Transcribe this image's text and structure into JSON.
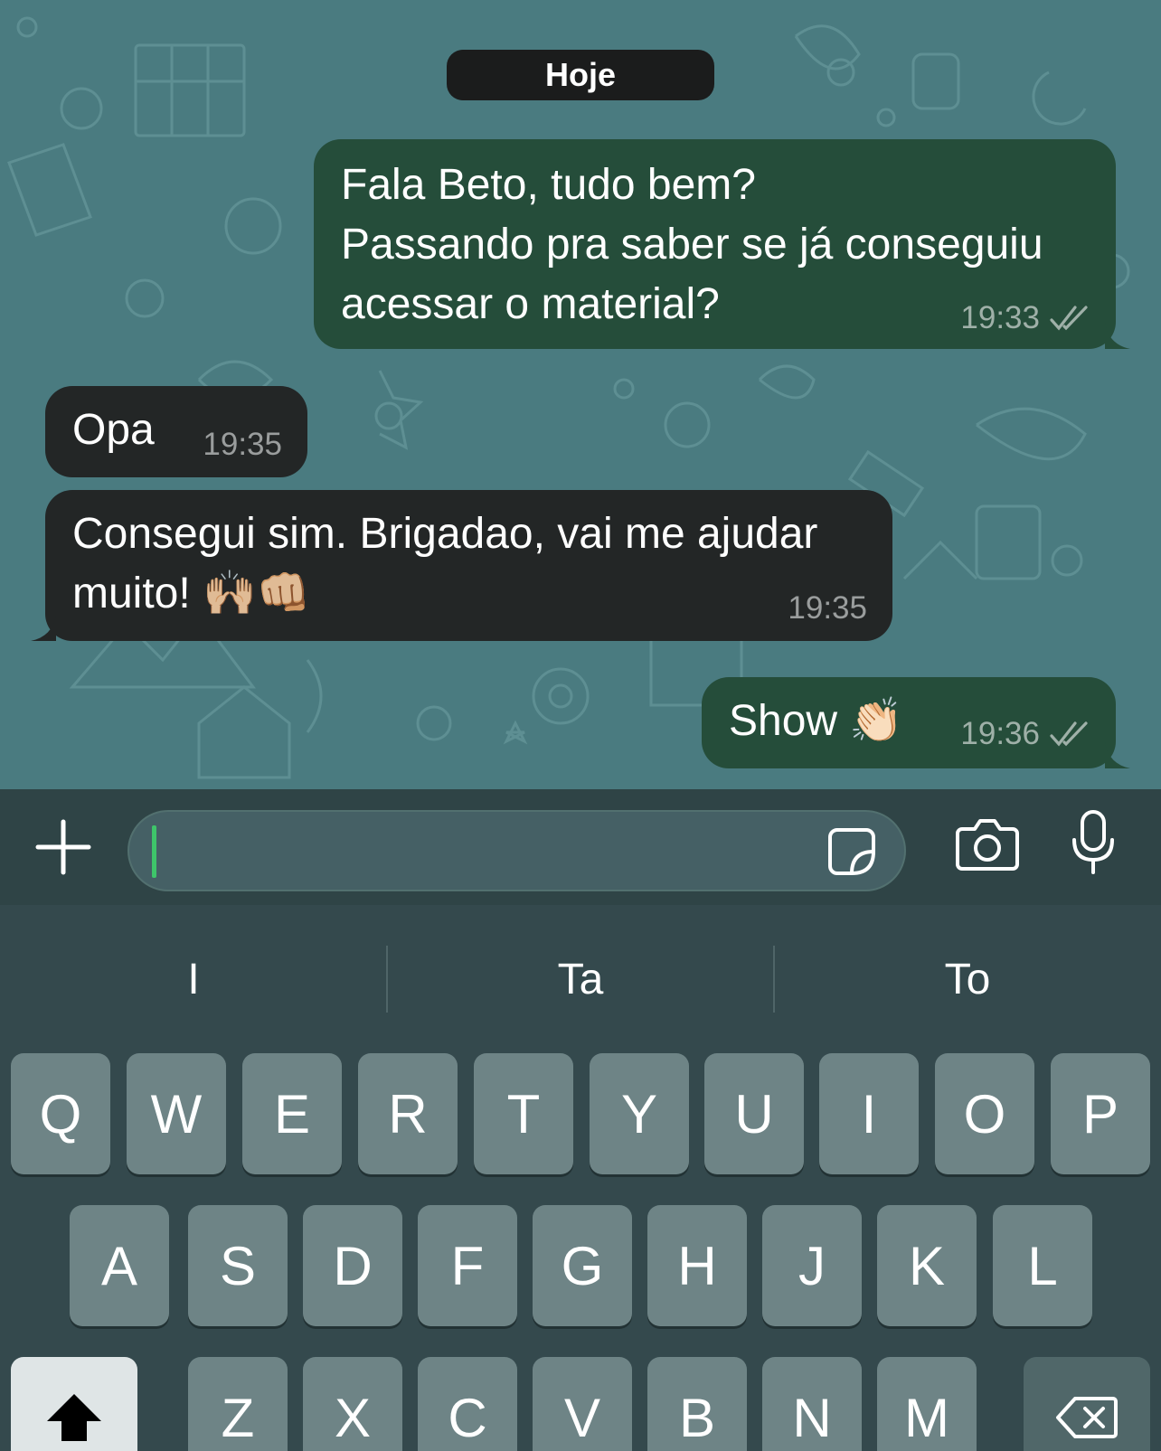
{
  "date_label": "Hoje",
  "messages": [
    {
      "direction": "outgoing",
      "text": "Fala Beto, tudo bem?\nPassando pra saber se já conseguiu\nacessar o material?",
      "time": "19:33",
      "status": "read"
    },
    {
      "direction": "incoming",
      "text": "Opa",
      "time": "19:35"
    },
    {
      "direction": "incoming",
      "text": "Consegui sim. Brigadao, vai me ajudar\nmuito! 🙌🏼👊🏼",
      "time": "19:35"
    },
    {
      "direction": "outgoing",
      "text": "Show 👏🏻",
      "time": "19:36",
      "status": "read"
    }
  ],
  "composer": {
    "input_value": "",
    "icons": [
      "plus-icon",
      "sticker-icon",
      "camera-icon",
      "microphone-icon"
    ]
  },
  "keyboard": {
    "suggestions": [
      "I",
      "Ta",
      "To"
    ],
    "row1": [
      "Q",
      "W",
      "E",
      "R",
      "T",
      "Y",
      "U",
      "I",
      "O",
      "P"
    ],
    "row2": [
      "A",
      "S",
      "D",
      "F",
      "G",
      "H",
      "J",
      "K",
      "L"
    ],
    "row3": [
      "Z",
      "X",
      "C",
      "V",
      "B",
      "N",
      "M"
    ],
    "special_keys": [
      "shift-icon",
      "backspace-icon"
    ]
  },
  "colors": {
    "chat_background": "#4a7b80",
    "outgoing_bubble": "#254d3a",
    "incoming_bubble": "#232626",
    "caret": "#3ec56a",
    "read_ticks": "#9fb0a8"
  }
}
